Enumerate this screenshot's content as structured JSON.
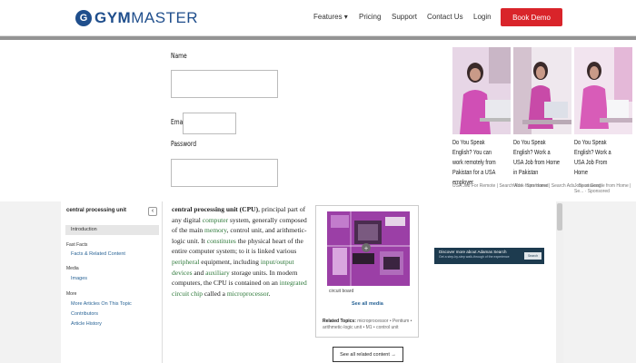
{
  "header": {
    "logo_letter": "G",
    "logo_strong": "GYM",
    "logo_light": "MASTER",
    "nav": [
      "Features ▾",
      "Pricing",
      "Support",
      "Contact Us",
      "Login"
    ],
    "cta": "Book Demo"
  },
  "form": {
    "name_label": "Name",
    "email_label": "Email",
    "password_label": "Password"
  },
  "ads": [
    {
      "title": "Do You Speak English? You can work remotely from Pakistan for a USA employer",
      "source": "USA Job For Remote | Search Ads · Sponsored"
    },
    {
      "title": "Do You Speak English? Work a USA Job from Home in Pakistan",
      "source": "Work from Home | Search Ads · Sponsored"
    },
    {
      "title": "Do You Speak English? Work a USA Job From Home",
      "source": "Jobs at Google from Home | Se... · Sponsored"
    }
  ],
  "sidebar": {
    "title": "central processing unit",
    "collapse": "‹",
    "selected": "Introduction",
    "sections": [
      {
        "heading": "Fast Facts",
        "links": [
          "Facts & Related Content"
        ]
      },
      {
        "heading": "Media",
        "links": [
          "Images"
        ]
      },
      {
        "heading": "More",
        "links": [
          "More Articles On This Topic",
          "Contributors",
          "Article History"
        ]
      }
    ]
  },
  "article": {
    "term": "central processing unit (CPU)",
    "p1": ", principal part of any digital ",
    "computer": "computer",
    "p2": " system, generally composed of the main ",
    "memory": "memory",
    "p3": ", control unit, and arithmetic-logic unit. It ",
    "constitutes": "constitutes",
    "p4": " the physical heart of the entire computer system; to it is linked various ",
    "peripheral": "peripheral",
    "p5": " equipment, including ",
    "io": "input/output devices",
    "p6": " and ",
    "auxiliary": "auxiliary",
    "p7": " storage units. In modern computers, the CPU is contained on an ",
    "ic": "integrated circuit chip",
    "p8": " called a ",
    "micro": "microprocessor",
    "p9": "."
  },
  "media": {
    "caption": "circuit board",
    "see_all": "See all media",
    "related_label": "Related Topics:",
    "related_text": " microprocessor • Pentium • arithmetic-logic unit • M1 • control unit",
    "related_button": "See all related content →"
  },
  "banner": {
    "line1": "Discover more about Adamas Search",
    "line2": "Get a step-by-step walk-through of the experience",
    "button": "Search"
  },
  "colors": {
    "brand": "#1f4e8c",
    "cta": "#d9242a",
    "link": "#2f7a3b"
  }
}
